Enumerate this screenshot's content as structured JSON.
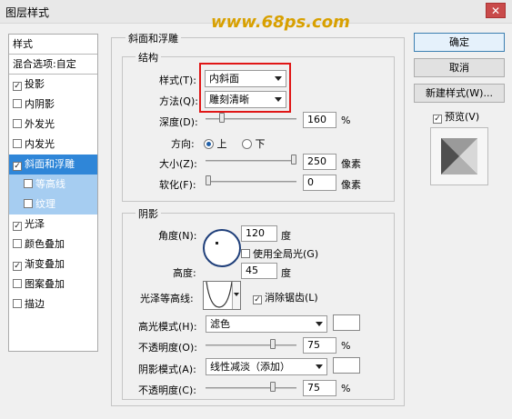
{
  "window": {
    "title": "图层样式",
    "close_label": "✕"
  },
  "watermark": "www.68ps.com",
  "left_list": {
    "header": "样式",
    "blend": "混合选项:自定",
    "items": [
      {
        "label": "投影",
        "checked": "✓"
      },
      {
        "label": "内阴影",
        "checked": ""
      },
      {
        "label": "外发光",
        "checked": ""
      },
      {
        "label": "内发光",
        "checked": ""
      },
      {
        "label": "斜面和浮雕",
        "checked": "✓"
      },
      {
        "label": "等高线",
        "checked": ""
      },
      {
        "label": "纹理",
        "checked": ""
      },
      {
        "label": "光泽",
        "checked": "✓"
      },
      {
        "label": "颜色叠加",
        "checked": ""
      },
      {
        "label": "渐变叠加",
        "checked": "✓"
      },
      {
        "label": "图案叠加",
        "checked": ""
      },
      {
        "label": "描边",
        "checked": ""
      }
    ]
  },
  "bevel": {
    "section_title": "斜面和浮雕",
    "structure_title": "结构",
    "style_label": "样式(T):",
    "style_value": "内斜面",
    "method_label": "方法(Q):",
    "method_value": "雕刻清晰",
    "depth_label": "深度(D):",
    "depth_value": "160",
    "depth_unit": "%",
    "depth_fraction": 0.16,
    "direction_label": "方向:",
    "dir_up": "上",
    "dir_down": "下",
    "size_label": "大小(Z):",
    "size_value": "250",
    "size_unit": "像素",
    "size_fraction": 1.0,
    "soften_label": "软化(F):",
    "soften_value": "0",
    "soften_unit": "像素",
    "soften_fraction": 0.0
  },
  "shading": {
    "title": "阴影",
    "angle_label": "角度(N):",
    "angle_value": "120",
    "angle_unit": "度",
    "global_light": "使用全局光(G)",
    "altitude_label": "高度:",
    "altitude_value": "45",
    "altitude_unit": "度",
    "gloss_label": "光泽等高线:",
    "antialias": "消除锯齿(L)",
    "highlight_mode_label": "高光模式(H):",
    "highlight_mode_value": "滤色",
    "highlight_opacity_label": "不透明度(O):",
    "highlight_opacity_value": "75",
    "highlight_opacity_fraction": 0.75,
    "shadow_mode_label": "阴影模式(A):",
    "shadow_mode_value": "线性减淡（添加）",
    "shadow_opacity_label": "不透明度(C):",
    "shadow_opacity_value": "75",
    "shadow_opacity_fraction": 0.75,
    "percent": "%"
  },
  "buttons": {
    "ok": "确定",
    "cancel": "取消",
    "new_style": "新建样式(W)...",
    "preview": "预览(V)"
  },
  "colors": {
    "selected_row": "#2f86d8",
    "sub_row": "#a6cdf1",
    "highlight_box": "#e01616"
  }
}
